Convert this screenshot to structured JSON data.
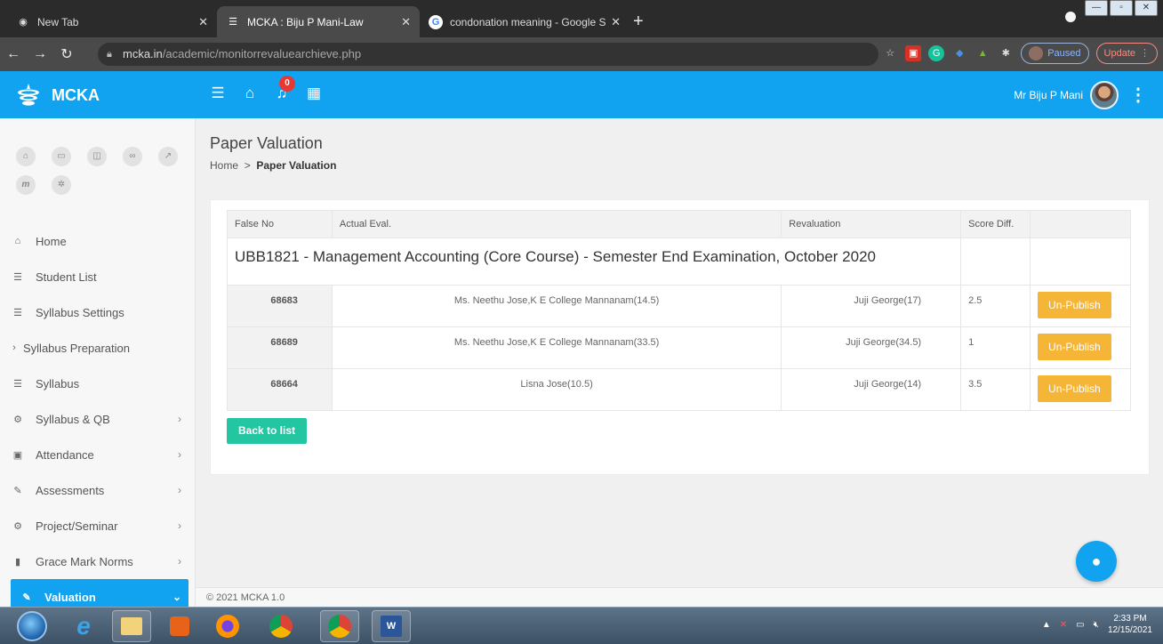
{
  "browser": {
    "tabs": [
      {
        "title": "New Tab"
      },
      {
        "title": "MCKA : Biju P Mani-Law"
      },
      {
        "title": "condonation meaning - Google S"
      }
    ],
    "url_host": "mcka.in",
    "url_path": "/academic/monitorrevaluearchieve.php",
    "paused_label": "Paused",
    "update_label": "Update"
  },
  "app": {
    "brand": "MCKA",
    "notification_count": "0",
    "user_name": "Mr Biju P Mani",
    "accent_color": "#11a3f0"
  },
  "sidebar": {
    "items": [
      {
        "label": "Home",
        "icon": "home-icon"
      },
      {
        "label": "Student List",
        "icon": "list-icon"
      },
      {
        "label": "Syllabus Settings",
        "icon": "list-icon"
      },
      {
        "label": "Syllabus Preparation",
        "icon": "chevron-right-icon"
      },
      {
        "label": "Syllabus",
        "icon": "list-icon"
      },
      {
        "label": "Syllabus & QB",
        "icon": "cogs-icon"
      },
      {
        "label": "Attendance",
        "icon": "calendar-icon"
      },
      {
        "label": "Assessments",
        "icon": "pencil-icon"
      },
      {
        "label": "Project/Seminar",
        "icon": "cogs-icon"
      },
      {
        "label": "Grace Mark Norms",
        "icon": "book-icon"
      },
      {
        "label": "Valuation",
        "icon": "pencil-icon"
      }
    ]
  },
  "page": {
    "title": "Paper Valuation",
    "breadcrumb_home": "Home",
    "breadcrumb_sep": ">",
    "breadcrumb_current": "Paper Valuation",
    "table_caption": "UBB1821 - Management Accounting (Core Course) - Semester End Examination, October 2020",
    "columns": [
      "False No",
      "Actual Eval.",
      "Revaluation",
      "Score Diff.",
      ""
    ],
    "rows": [
      {
        "false_no": "68683",
        "actual": "Ms. Neethu Jose,K E College Mannanam(14.5)",
        "reval": "Juji George(17)",
        "diff": "2.5",
        "action": "Un-Publish"
      },
      {
        "false_no": "68689",
        "actual": "Ms. Neethu Jose,K E College Mannanam(33.5)",
        "reval": "Juji George(34.5)",
        "diff": "1",
        "action": "Un-Publish"
      },
      {
        "false_no": "68664",
        "actual": "Lisna Jose(10.5)",
        "reval": "Juji George(14)",
        "diff": "3.5",
        "action": "Un-Publish"
      }
    ],
    "back_label": "Back to list",
    "footer": "© 2021 MCKA 1.0"
  },
  "taskbar": {
    "time": "2:33 PM",
    "date": "12/15/2021"
  }
}
